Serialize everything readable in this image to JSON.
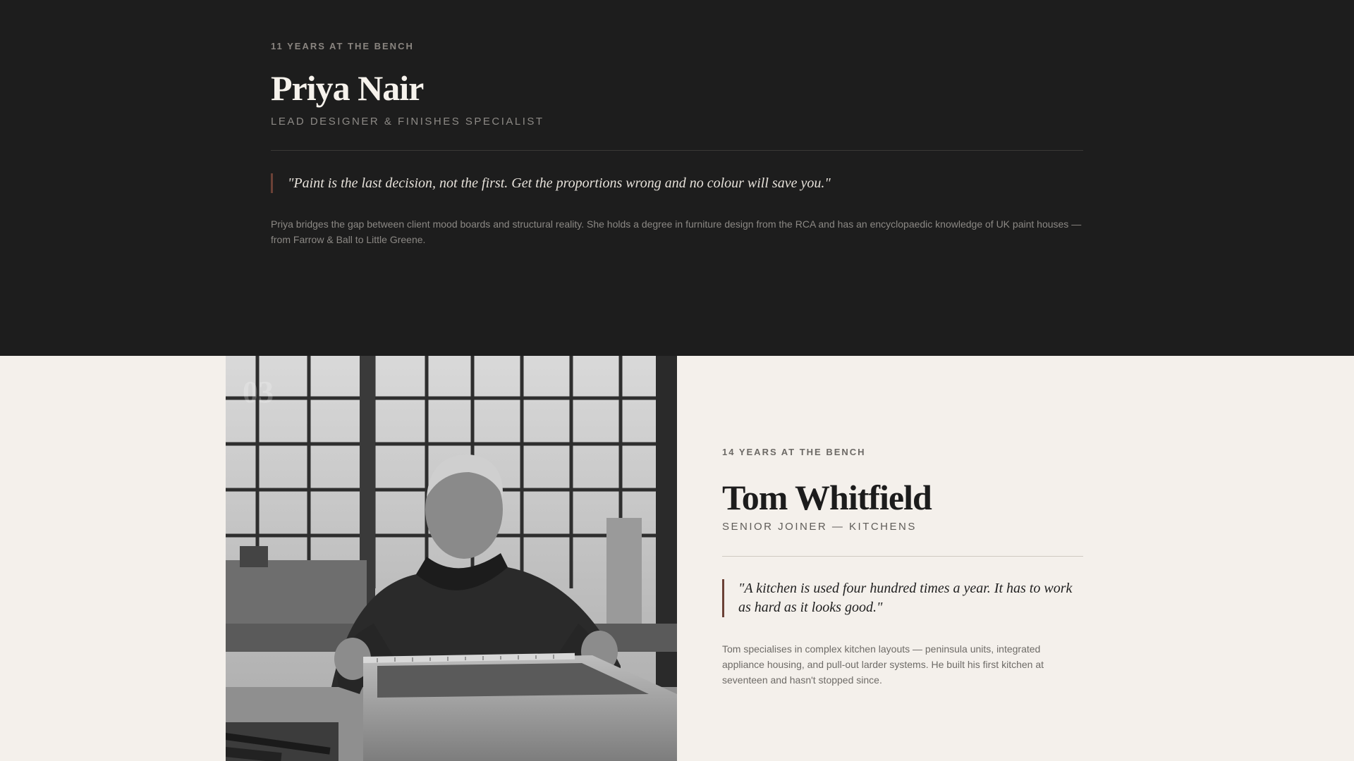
{
  "priya": {
    "years": "11 YEARS AT THE BENCH",
    "name": "Priya Nair",
    "role": "LEAD DESIGNER & FINISHES SPECIALIST",
    "quote": "\"Paint is the last decision, not the first. Get the proportions wrong and no colour will save you.\"",
    "bio": "Priya bridges the gap between client mood boards and structural reality. She holds a degree in furniture design from the RCA and has an encyclopaedic knowledge of UK paint houses — from Farrow & Ball to Little Greene."
  },
  "tom": {
    "number": "03",
    "photo_icon": "portrait-photo",
    "years": "14 YEARS AT THE BENCH",
    "name": "Tom Whitfield",
    "role": "SENIOR JOINER — KITCHENS",
    "quote": "\"A kitchen is used four hundred times a year. It has to work as hard as it looks good.\"",
    "bio": "Tom specialises in complex kitchen layouts — peninsula units, integrated appliance housing, and pull-out larder systems. He built his first kitchen at seventeen and hasn't stopped since."
  },
  "colors": {
    "dark_bg": "#1d1d1d",
    "light_bg": "#f4f0eb",
    "accent": "#6b4136"
  }
}
